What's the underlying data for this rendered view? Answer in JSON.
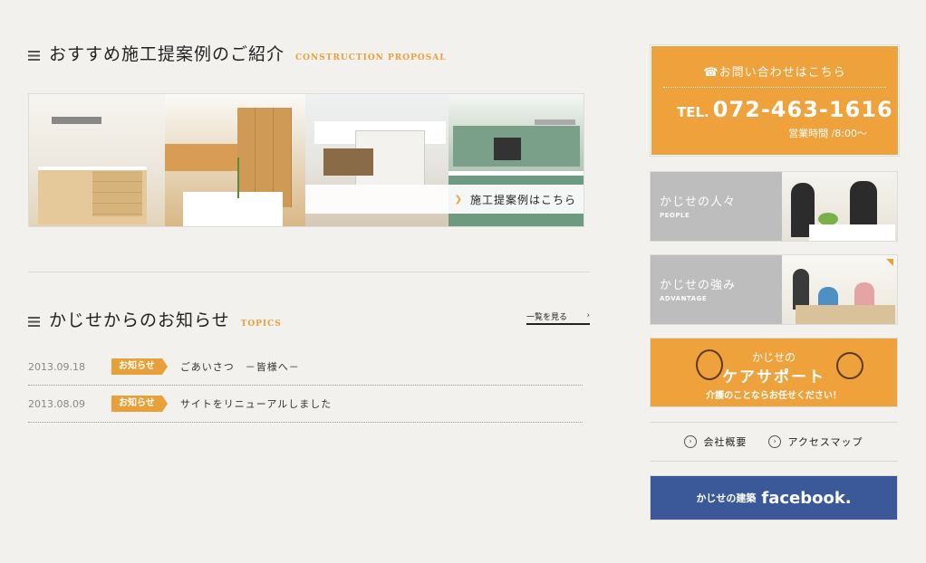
{
  "proposal": {
    "title_jp": "おすすめ施工提案例のご紹介",
    "title_en": "CONSTRUCTION PROPOSAL",
    "banner_link": "施工提案例はこちら"
  },
  "topics": {
    "title_jp": "かじせからのお知らせ",
    "title_en": "TOPICS",
    "view_all": "一覧を見る",
    "items": [
      {
        "date": "2013.09.18",
        "badge": "お知らせ",
        "title": "ごあいさつ　－皆様へ－"
      },
      {
        "date": "2013.08.09",
        "badge": "お知らせ",
        "title": "サイトをリニューアルしました"
      }
    ]
  },
  "sidebar": {
    "contact": {
      "heading": "お問い合わせはこちら",
      "tel_label": "TEL.",
      "tel_number": "072-463-1616",
      "hours": "営業時間 /8:00～"
    },
    "people": {
      "jp": "かじせの人々",
      "en": "PEOPLE"
    },
    "advantage": {
      "jp": "かじせの強み",
      "en": "ADVANTAGE"
    },
    "care": {
      "line1": "かじせの",
      "line2": "ケアサポート",
      "line3": "介護のことならお任せください！"
    },
    "links": [
      "会社概要",
      "アクセスマップ"
    ],
    "facebook": {
      "jp": "かじせの建築",
      "brand": "facebook."
    }
  },
  "colors": {
    "accent": "#efa23b",
    "facebook": "#3b5998",
    "card_gray": "#bdbdbd"
  }
}
